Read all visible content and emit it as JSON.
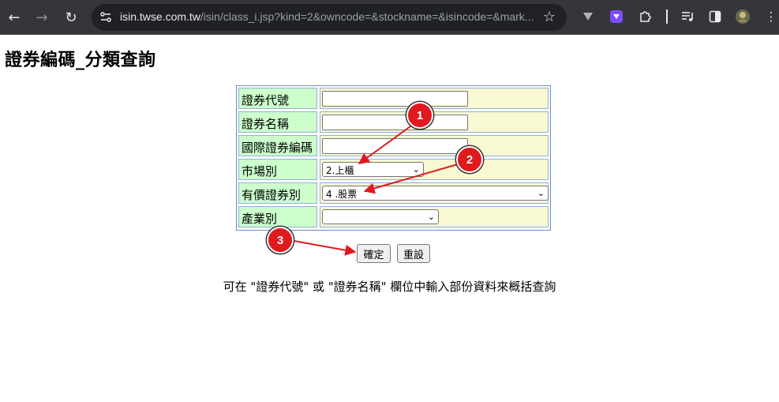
{
  "browser": {
    "url_host": "isin.twse.com.tw",
    "url_path": "/isin/class_i.jsp?kind=2&owncode=&stockname=&isincode=&mark...",
    "back_icon": "arrow-left",
    "forward_icon": "arrow-right",
    "reload_icon": "reload",
    "star_icon": "star"
  },
  "page": {
    "title": "證券編碼_分類查詢",
    "hint": "可在 \"證券代號\" 或 \"證券名稱\" 欄位中輸入部份資料來概括查詢"
  },
  "form": {
    "rows": [
      {
        "label": "證券代號",
        "value": ""
      },
      {
        "label": "證券名稱",
        "value": ""
      },
      {
        "label": "國際證券編碼",
        "value": ""
      },
      {
        "label": "市場別",
        "value": "2.上櫃"
      },
      {
        "label": "有價證券別",
        "value": "4 .股票"
      },
      {
        "label": "產業別",
        "value": ""
      }
    ],
    "submit_label": "確定",
    "reset_label": "重設"
  },
  "annotations": {
    "markers": [
      "1",
      "2",
      "3"
    ],
    "color": "#e0191f"
  }
}
